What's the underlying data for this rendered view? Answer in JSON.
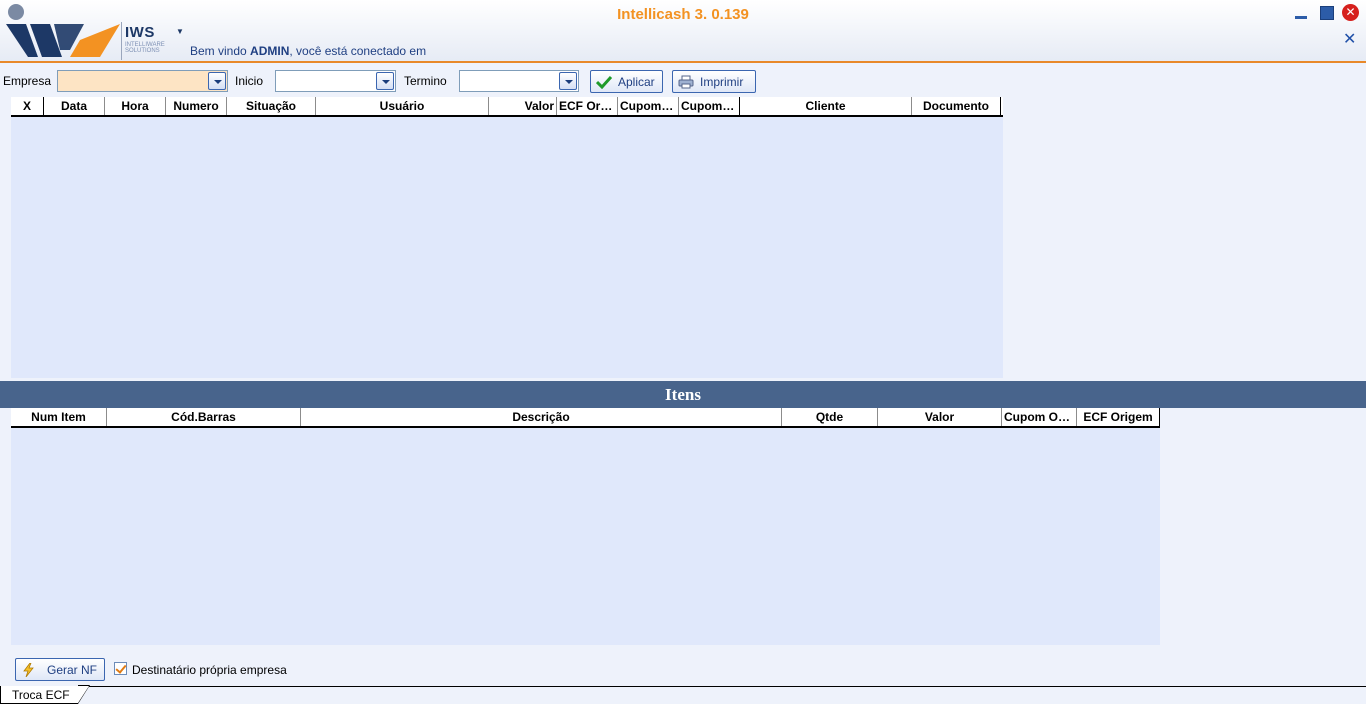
{
  "header": {
    "app_title": "Intellicash 3. 0.139",
    "logo_text": "IWS",
    "logo_subtext": "INTELLIWARE SOLUTIONS",
    "welcome_prefix": "Bem vindo ",
    "user": "ADMIN",
    "welcome_suffix": ", você está conectado em",
    "minimize_icon": "minimize-icon",
    "maximize_icon": "maximize-icon",
    "close_icon": "close-circle-icon",
    "close_tab_icon": "close-x-icon"
  },
  "filters": {
    "empresa_label": "Empresa",
    "empresa_value": "",
    "inicio_label": "Inicio",
    "inicio_value": "",
    "termino_label": "Termino",
    "termino_value": "",
    "aplicar_label": "Aplicar",
    "imprimir_label": "Imprimir"
  },
  "main_grid": {
    "columns": [
      "X",
      "Data",
      "Hora",
      "Numero",
      "Situação",
      "Usuário",
      "Valor",
      "ECF Origem",
      "Cupom Origem",
      "Cupom Troca",
      "Cliente",
      "Documento"
    ],
    "rows": []
  },
  "items": {
    "title": "Itens",
    "columns": [
      "Num Item",
      "Cód.Barras",
      "Descrição",
      "Qtde",
      "Valor",
      "Cupom Origem",
      "ECF Origem"
    ],
    "rows": []
  },
  "footer": {
    "gerar_label": "Gerar NF",
    "destinatario_label": "Destinatário própria empresa",
    "destinatario_checked": true,
    "tab_label": "Troca ECF"
  },
  "colors": {
    "accent_orange": "#f39222",
    "header_band": "#48648c",
    "grid_bg": "#e0e8fb",
    "brand_blue": "#1d3866"
  }
}
